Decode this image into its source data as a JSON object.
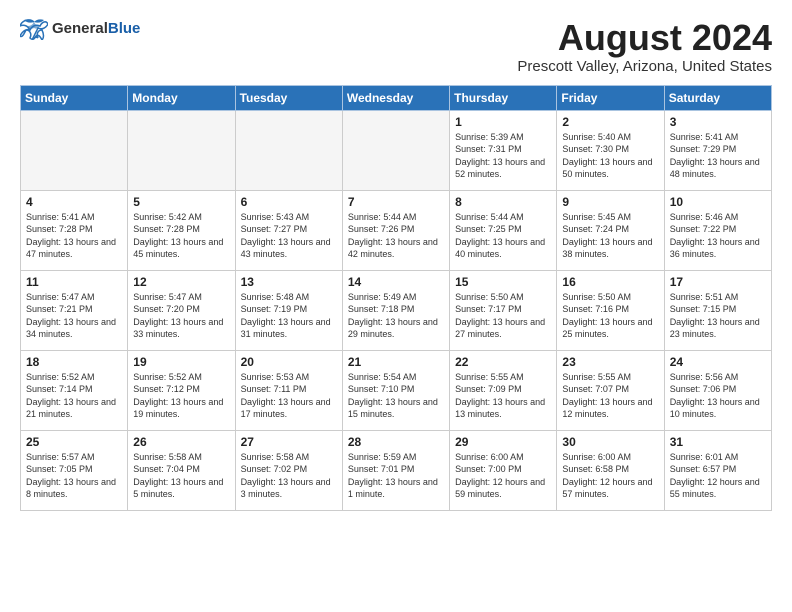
{
  "header": {
    "logo_general": "General",
    "logo_blue": "Blue",
    "title": "August 2024",
    "location": "Prescott Valley, Arizona, United States"
  },
  "days_of_week": [
    "Sunday",
    "Monday",
    "Tuesday",
    "Wednesday",
    "Thursday",
    "Friday",
    "Saturday"
  ],
  "weeks": [
    [
      {
        "day": "",
        "empty": true
      },
      {
        "day": "",
        "empty": true
      },
      {
        "day": "",
        "empty": true
      },
      {
        "day": "",
        "empty": true
      },
      {
        "day": "1",
        "sunrise": "5:39 AM",
        "sunset": "7:31 PM",
        "daylight": "13 hours and 52 minutes."
      },
      {
        "day": "2",
        "sunrise": "5:40 AM",
        "sunset": "7:30 PM",
        "daylight": "13 hours and 50 minutes."
      },
      {
        "day": "3",
        "sunrise": "5:41 AM",
        "sunset": "7:29 PM",
        "daylight": "13 hours and 48 minutes."
      }
    ],
    [
      {
        "day": "4",
        "sunrise": "5:41 AM",
        "sunset": "7:28 PM",
        "daylight": "13 hours and 47 minutes."
      },
      {
        "day": "5",
        "sunrise": "5:42 AM",
        "sunset": "7:28 PM",
        "daylight": "13 hours and 45 minutes."
      },
      {
        "day": "6",
        "sunrise": "5:43 AM",
        "sunset": "7:27 PM",
        "daylight": "13 hours and 43 minutes."
      },
      {
        "day": "7",
        "sunrise": "5:44 AM",
        "sunset": "7:26 PM",
        "daylight": "13 hours and 42 minutes."
      },
      {
        "day": "8",
        "sunrise": "5:44 AM",
        "sunset": "7:25 PM",
        "daylight": "13 hours and 40 minutes."
      },
      {
        "day": "9",
        "sunrise": "5:45 AM",
        "sunset": "7:24 PM",
        "daylight": "13 hours and 38 minutes."
      },
      {
        "day": "10",
        "sunrise": "5:46 AM",
        "sunset": "7:22 PM",
        "daylight": "13 hours and 36 minutes."
      }
    ],
    [
      {
        "day": "11",
        "sunrise": "5:47 AM",
        "sunset": "7:21 PM",
        "daylight": "13 hours and 34 minutes."
      },
      {
        "day": "12",
        "sunrise": "5:47 AM",
        "sunset": "7:20 PM",
        "daylight": "13 hours and 33 minutes."
      },
      {
        "day": "13",
        "sunrise": "5:48 AM",
        "sunset": "7:19 PM",
        "daylight": "13 hours and 31 minutes."
      },
      {
        "day": "14",
        "sunrise": "5:49 AM",
        "sunset": "7:18 PM",
        "daylight": "13 hours and 29 minutes."
      },
      {
        "day": "15",
        "sunrise": "5:50 AM",
        "sunset": "7:17 PM",
        "daylight": "13 hours and 27 minutes."
      },
      {
        "day": "16",
        "sunrise": "5:50 AM",
        "sunset": "7:16 PM",
        "daylight": "13 hours and 25 minutes."
      },
      {
        "day": "17",
        "sunrise": "5:51 AM",
        "sunset": "7:15 PM",
        "daylight": "13 hours and 23 minutes."
      }
    ],
    [
      {
        "day": "18",
        "sunrise": "5:52 AM",
        "sunset": "7:14 PM",
        "daylight": "13 hours and 21 minutes."
      },
      {
        "day": "19",
        "sunrise": "5:52 AM",
        "sunset": "7:12 PM",
        "daylight": "13 hours and 19 minutes."
      },
      {
        "day": "20",
        "sunrise": "5:53 AM",
        "sunset": "7:11 PM",
        "daylight": "13 hours and 17 minutes."
      },
      {
        "day": "21",
        "sunrise": "5:54 AM",
        "sunset": "7:10 PM",
        "daylight": "13 hours and 15 minutes."
      },
      {
        "day": "22",
        "sunrise": "5:55 AM",
        "sunset": "7:09 PM",
        "daylight": "13 hours and 13 minutes."
      },
      {
        "day": "23",
        "sunrise": "5:55 AM",
        "sunset": "7:07 PM",
        "daylight": "13 hours and 12 minutes."
      },
      {
        "day": "24",
        "sunrise": "5:56 AM",
        "sunset": "7:06 PM",
        "daylight": "13 hours and 10 minutes."
      }
    ],
    [
      {
        "day": "25",
        "sunrise": "5:57 AM",
        "sunset": "7:05 PM",
        "daylight": "13 hours and 8 minutes."
      },
      {
        "day": "26",
        "sunrise": "5:58 AM",
        "sunset": "7:04 PM",
        "daylight": "13 hours and 5 minutes."
      },
      {
        "day": "27",
        "sunrise": "5:58 AM",
        "sunset": "7:02 PM",
        "daylight": "13 hours and 3 minutes."
      },
      {
        "day": "28",
        "sunrise": "5:59 AM",
        "sunset": "7:01 PM",
        "daylight": "13 hours and 1 minute."
      },
      {
        "day": "29",
        "sunrise": "6:00 AM",
        "sunset": "7:00 PM",
        "daylight": "12 hours and 59 minutes."
      },
      {
        "day": "30",
        "sunrise": "6:00 AM",
        "sunset": "6:58 PM",
        "daylight": "12 hours and 57 minutes."
      },
      {
        "day": "31",
        "sunrise": "6:01 AM",
        "sunset": "6:57 PM",
        "daylight": "12 hours and 55 minutes."
      }
    ]
  ]
}
